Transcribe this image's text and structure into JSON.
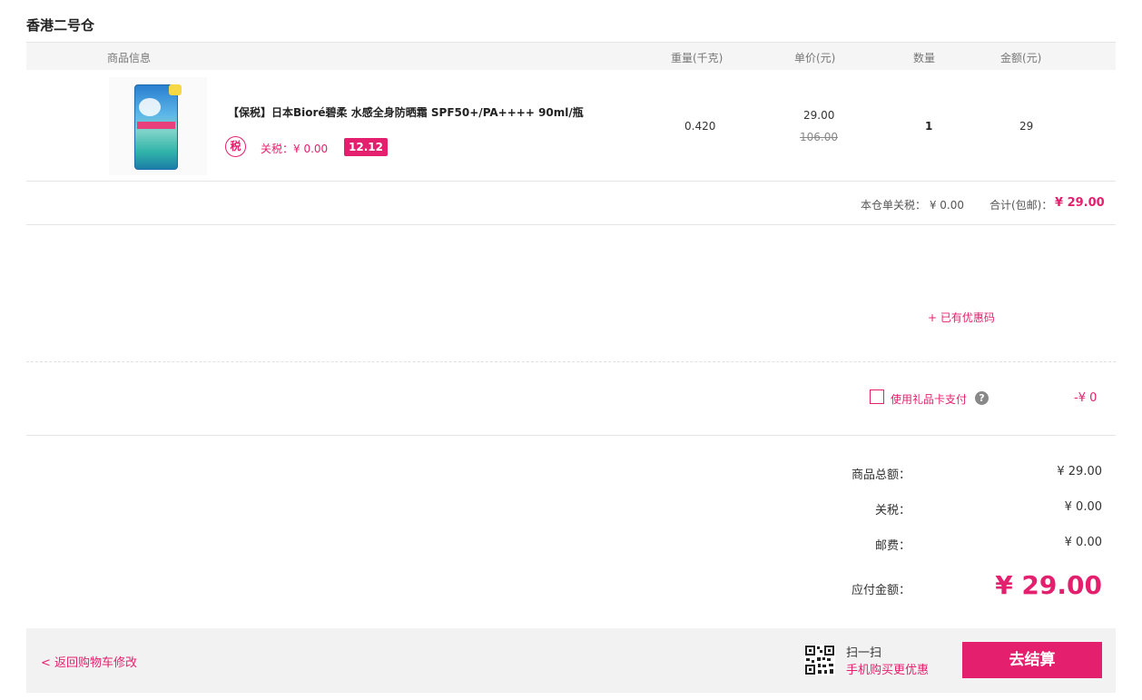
{
  "warehouse": {
    "title": "香港二号仓"
  },
  "table": {
    "headers": {
      "product": "商品信息",
      "weight": "重量(千克)",
      "unit_price": "单价(元)",
      "quantity": "数量",
      "amount": "金额(元)"
    }
  },
  "product": {
    "name": "【保税】日本Bioré碧柔 水感全身防晒霜 SPF50+/PA++++ 90ml/瓶",
    "tax_icon": "税",
    "tax_text": "关税：¥ 0.00",
    "promo_badge": "12.12",
    "weight": "0.420",
    "price_now": "29.00",
    "price_old": "106.00",
    "quantity": "1",
    "amount": "29"
  },
  "subtotal": {
    "tax": "本仓单关税： ¥ 0.00",
    "total_label": "合计(包邮)：",
    "total_value": "¥ 29.00"
  },
  "coupon": {
    "link": "+ 已有优惠码"
  },
  "gift_card": {
    "label": "使用礼品卡支付",
    "help": "?",
    "amount": "-¥  0"
  },
  "summary": {
    "goods_label": "商品总额：",
    "goods_value": "¥ 29.00",
    "tax_label": "关税：",
    "tax_value": "¥ 0.00",
    "shipping_label": "邮费：",
    "shipping_value": "¥ 0.00",
    "payable_label": "应付金额：",
    "payable_value": "¥ 29.00"
  },
  "footer": {
    "back_link": "< 返回购物车修改",
    "scan_title": "扫一扫",
    "scan_sub": "手机购买更优惠",
    "checkout": "去结算"
  },
  "colors": {
    "accent": "#e4206e"
  }
}
